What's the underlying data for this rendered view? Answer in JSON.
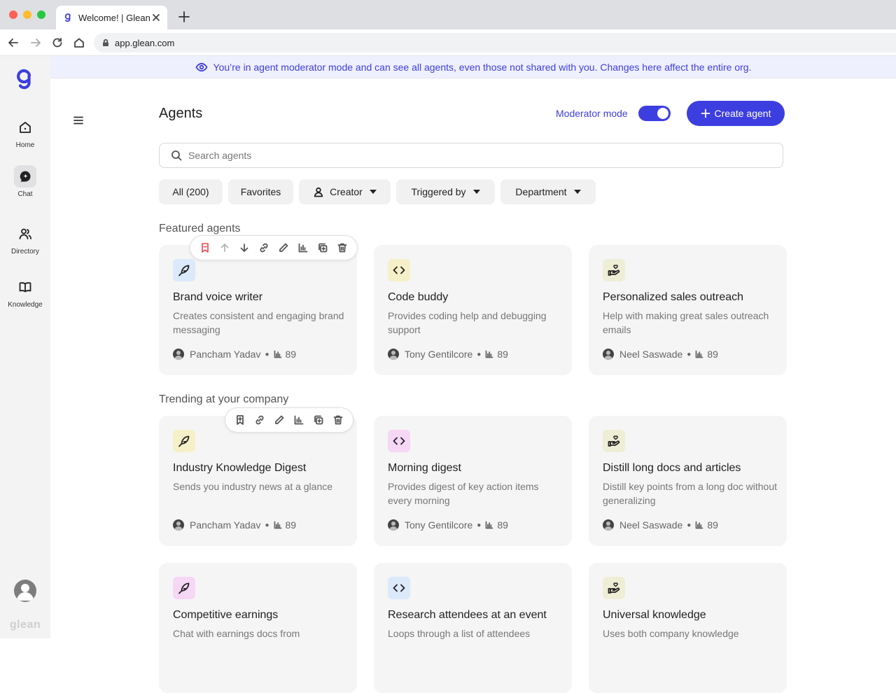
{
  "browser": {
    "tab_title": "Welcome! | Glean",
    "url": "app.glean.com"
  },
  "sidebar": {
    "brand": "glean",
    "items": [
      {
        "label": "Home",
        "icon": "home-icon"
      },
      {
        "label": "Chat",
        "icon": "chat-icon"
      },
      {
        "label": "Directory",
        "icon": "people-icon"
      },
      {
        "label": "Knowledge",
        "icon": "book-icon"
      }
    ]
  },
  "banner": {
    "text": "You’re in agent moderator mode and can see all agents, even those not shared with you. Changes here affect the entire org."
  },
  "header": {
    "title": "Agents",
    "moderator_label": "Moderator mode",
    "moderator_on": true,
    "create_label": "Create agent"
  },
  "search": {
    "placeholder": "Search agents"
  },
  "filters": [
    {
      "label": "All (200)"
    },
    {
      "label": "Favorites"
    },
    {
      "label": "Creator"
    },
    {
      "label": "Triggered by"
    },
    {
      "label": "Department"
    }
  ],
  "sections": [
    {
      "title": "Featured agents",
      "cards": [
        {
          "name": "Brand voice writer",
          "desc": "Creates consistent and engaging brand messaging",
          "author": "Pancham Yadav",
          "count": "89",
          "icon": "feather-icon",
          "tint": "#dbe9fb"
        },
        {
          "name": "Code buddy",
          "desc": "Provides coding help and debugging support",
          "author": "Tony Gentilcore",
          "count": "89",
          "icon": "code-icon",
          "tint": "#f6f0c9"
        },
        {
          "name": "Personalized sales outreach",
          "desc": "Help with making great sales outreach emails",
          "author": "Neel Saswade",
          "count": "89",
          "icon": "hand-heart-icon",
          "tint": "#eeeed7"
        }
      ]
    },
    {
      "title": "Trending at your company",
      "cards": [
        {
          "name": "Industry Knowledge Digest",
          "desc": "Sends you industry news at a glance",
          "author": "Pancham Yadav",
          "count": "89",
          "icon": "feather-icon",
          "tint": "#f6f0c9"
        },
        {
          "name": "Morning digest",
          "desc": "Provides digest of key action items every morning",
          "author": "Tony Gentilcore",
          "count": "89",
          "icon": "code-icon",
          "tint": "#f6d7f6"
        },
        {
          "name": "Distill long docs and articles",
          "desc": "Distill key points from a long doc without generalizing",
          "author": "Neel Saswade",
          "count": "89",
          "icon": "hand-heart-icon",
          "tint": "#eeeed7"
        }
      ]
    },
    {
      "title": "",
      "cards": [
        {
          "name": "Competitive earnings",
          "desc": "Chat with earnings docs from",
          "icon": "feather-icon",
          "tint": "#f6d7f6"
        },
        {
          "name": "Research attendees at an event",
          "desc": "Loops through a list of attendees",
          "icon": "code-icon",
          "tint": "#dbe9fb"
        },
        {
          "name": "Universal knowledge",
          "desc": "Uses both company knowledge",
          "icon": "hand-heart-icon",
          "tint": "#eeeed7"
        }
      ]
    }
  ],
  "colors": {
    "accent": "#3d3ee0",
    "unfeature": "#e5484d"
  }
}
